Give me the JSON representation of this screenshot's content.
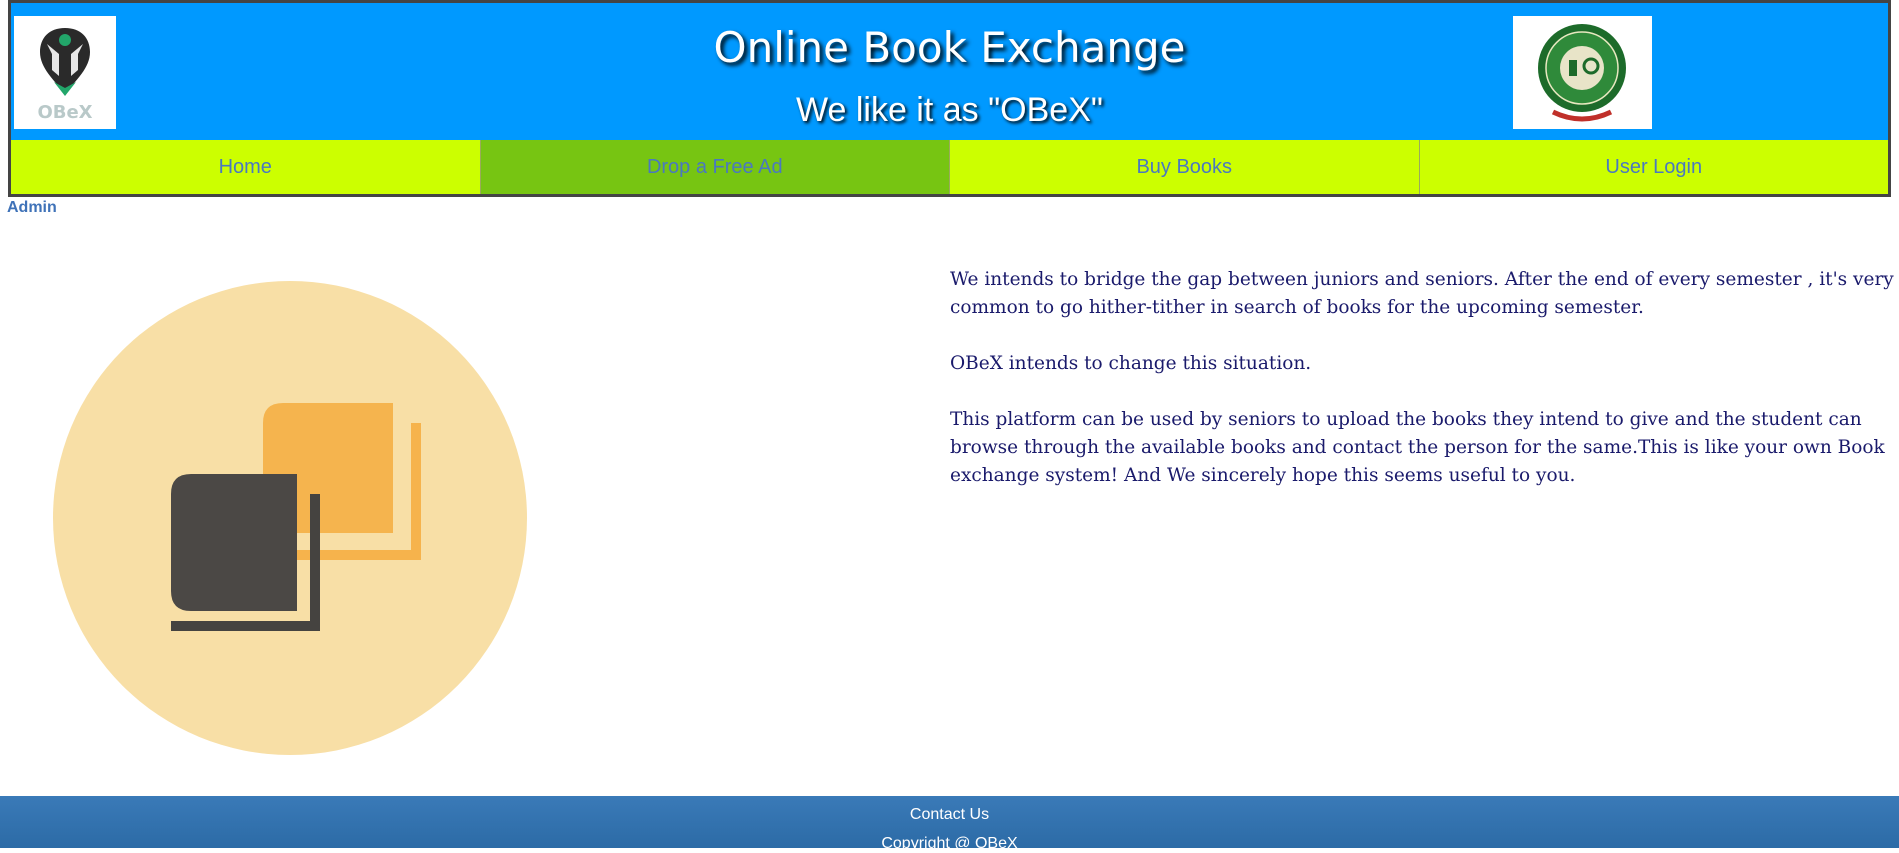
{
  "header": {
    "logo_caption": "OBeX",
    "title": "Online Book Exchange",
    "subtitle": "We like it as \"OBeX\"",
    "seal_text": "INDIRA GANDHI DELHI TECHNICAL UNIVERSITY FOR WOMEN"
  },
  "nav": {
    "items": [
      {
        "label": "Home"
      },
      {
        "label": "Drop a Free Ad",
        "active": true
      },
      {
        "label": "Buy Books"
      },
      {
        "label": "User Login"
      }
    ]
  },
  "admin_link": "Admin",
  "intro": {
    "paragraphs": [
      "We intends to bridge the gap between juniors and seniors. After the end of every semester , it's very common to go hither-tither in search of books for the upcoming semester.",
      "OBeX intends to change this situation.",
      "This platform can be used by seniors to upload the books they intend to give and the student can browse through the available books and contact the person for the same.This is like your own Book exchange system! And We sincerely hope this seems useful to you."
    ]
  },
  "footer": {
    "contact": "Contact Us",
    "copyright": "Copyright @ OBeX"
  },
  "colors": {
    "header_bg": "#0099ff",
    "nav_bg": "#ccff00",
    "nav_active_bg": "#77c512",
    "footer_bg": "#3276b1",
    "text_navy": "#1a1a6b"
  }
}
